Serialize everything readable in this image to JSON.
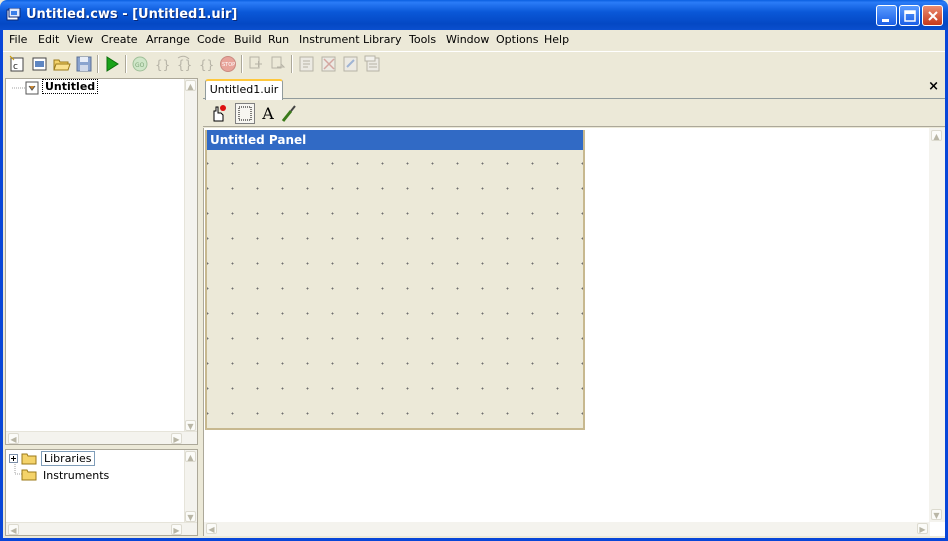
{
  "window": {
    "title": "Untitled.cws - [Untitled1.uir]"
  },
  "menu": [
    {
      "label": "File"
    },
    {
      "label": "Edit"
    },
    {
      "label": "View"
    },
    {
      "label": "Create"
    },
    {
      "label": "Arrange"
    },
    {
      "label": "Code"
    },
    {
      "label": "Build"
    },
    {
      "label": "Run"
    },
    {
      "label": "Instrument"
    },
    {
      "label": "Library"
    },
    {
      "label": "Tools"
    },
    {
      "label": "Window"
    },
    {
      "label": "Options"
    },
    {
      "label": "Help"
    }
  ],
  "toolbar": {
    "icons": [
      "new-project-icon",
      "new-uir-icon",
      "open-icon",
      "save-icon",
      "run-icon",
      "go-icon",
      "step-into-icon",
      "step-over-icon",
      "finish-function-icon",
      "stop-icon",
      "toggle-tag-icon",
      "next-tag-icon",
      "uir-edit-icon",
      "uir-delete-icon",
      "uir-properties-icon",
      "uir-code-icon"
    ]
  },
  "project_tree": {
    "root_label": "Untitled"
  },
  "library_tree": {
    "items": [
      {
        "label": "Libraries",
        "expandable": true
      },
      {
        "label": "Instruments",
        "expandable": false
      }
    ]
  },
  "tabs": [
    {
      "label": "Untitled1.uir",
      "active": true
    }
  ],
  "tab_close": "×",
  "uir_tools": [
    "operate-tool-icon",
    "edit-tool-icon",
    "label-tool-icon",
    "color-tool-icon"
  ],
  "uir_tool_text": {
    "label": "A"
  },
  "panel": {
    "title": "Untitled Panel"
  }
}
